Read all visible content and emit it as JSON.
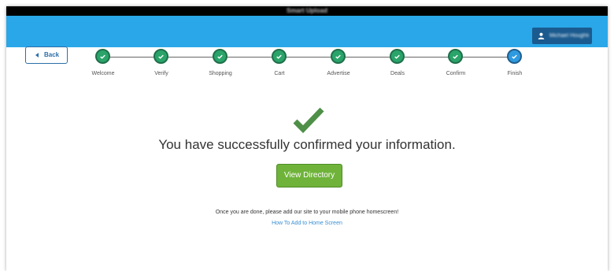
{
  "window": {
    "title": "Smart Upload"
  },
  "header": {
    "user_name": "Michael Houghton"
  },
  "nav": {
    "back_label": "Back"
  },
  "steps": [
    {
      "label": "Welcome",
      "status": "done"
    },
    {
      "label": "Verify",
      "status": "done"
    },
    {
      "label": "Shopping",
      "status": "done"
    },
    {
      "label": "Cart",
      "status": "done"
    },
    {
      "label": "Advertise",
      "status": "done"
    },
    {
      "label": "Deals",
      "status": "done"
    },
    {
      "label": "Confirm",
      "status": "done"
    },
    {
      "label": "Finish",
      "status": "current"
    }
  ],
  "main": {
    "success_message": "You have successfully confirmed your information.",
    "view_directory_label": "View Directory",
    "homescreen_note": "Once you are done, please add our site to your mobile phone homescreen!",
    "howto_link": "How To Add to Home Screen"
  },
  "colors": {
    "header_blue": "#2aa7e8",
    "step_done_green": "#2aa46a",
    "step_current_blue": "#2e9ae0",
    "success_check_green": "#4f8f48",
    "button_green": "#6fb33a",
    "link_blue": "#3a8fd2"
  },
  "icons": {
    "user": "user-icon",
    "back": "caret-left-icon",
    "step_check": "check-icon",
    "success": "large-check-icon"
  }
}
